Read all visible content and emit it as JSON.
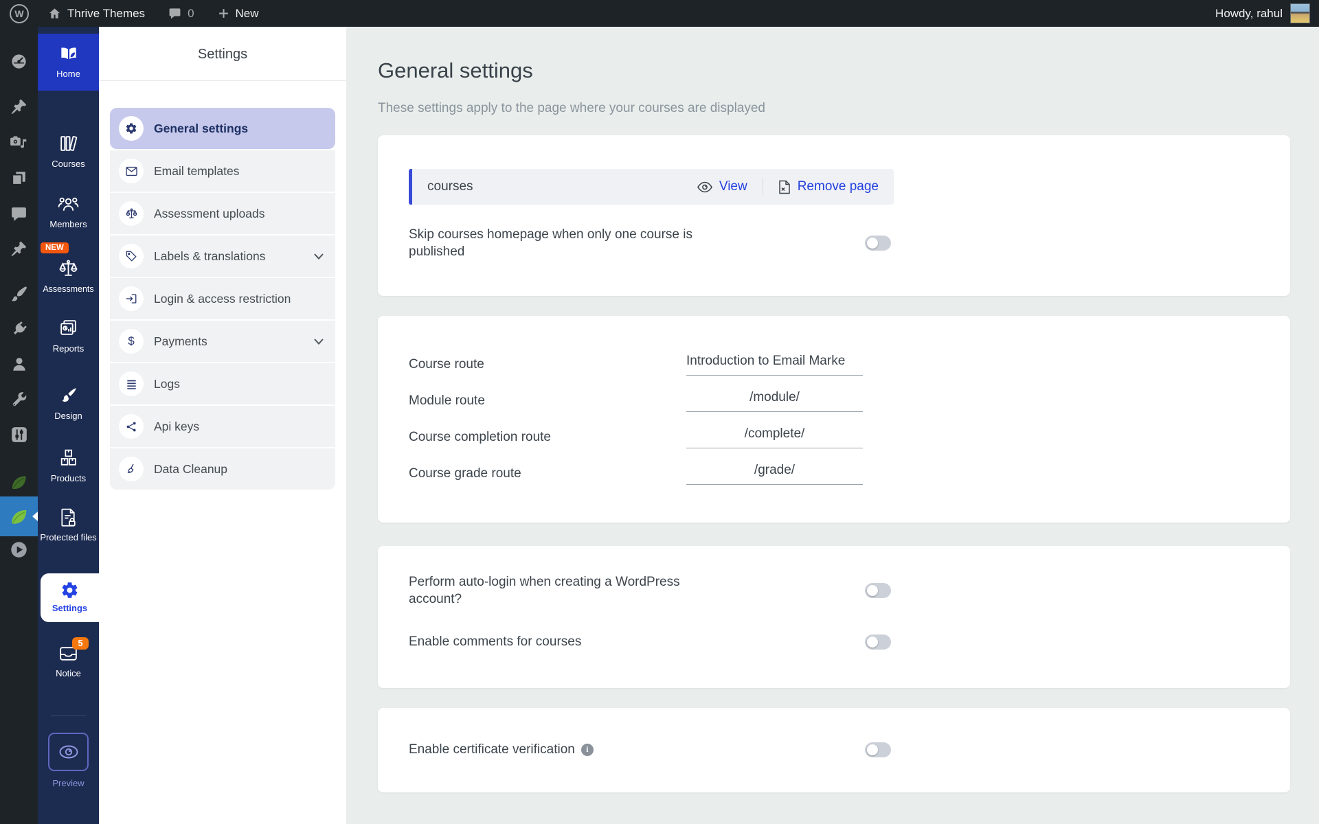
{
  "admin_bar": {
    "site_name": "Thrive Themes",
    "comments_count": "0",
    "new_label": "New",
    "greeting": "Howdy, rahul"
  },
  "wp_strip": {
    "icons": [
      "dashboard",
      "pushpin",
      "media-camera",
      "pages",
      "comments-bubble",
      "pushpin",
      "appearance-brush",
      "plugins-plug",
      "users-person",
      "tools-wrench",
      "settings-sliders",
      "thrive-leaf",
      "thrive-leaf-active",
      "video-play"
    ]
  },
  "thrive_nav": {
    "items": [
      {
        "label": "Home",
        "icon": "book-leaf",
        "active": true
      },
      {
        "label": "Courses",
        "icon": "bookshelf"
      },
      {
        "label": "Members",
        "icon": "people"
      },
      {
        "label": "Assessments",
        "icon": "scales",
        "badge": "NEW"
      },
      {
        "label": "Reports",
        "icon": "report-card"
      },
      {
        "label": "Design",
        "icon": "paintbrush"
      },
      {
        "label": "Products",
        "icon": "boxes"
      },
      {
        "label": "Protected files",
        "icon": "document-lock"
      },
      {
        "label": "Settings",
        "icon": "gear",
        "active": true
      },
      {
        "label": "Notice",
        "icon": "inbox",
        "badge": "5"
      },
      {
        "label": "Preview",
        "icon": "eye"
      }
    ]
  },
  "settings_menu": {
    "title": "Settings",
    "items": [
      {
        "label": "General settings",
        "icon": "gear",
        "active": true
      },
      {
        "label": "Email templates",
        "icon": "envelope"
      },
      {
        "label": "Assessment uploads",
        "icon": "scales"
      },
      {
        "label": "Labels & translations",
        "icon": "tag",
        "expandable": true
      },
      {
        "label": "Login & access restriction",
        "icon": "login-arrow"
      },
      {
        "label": "Payments",
        "icon": "dollar",
        "expandable": true
      },
      {
        "label": "Logs",
        "icon": "list-lines"
      },
      {
        "label": "Api keys",
        "icon": "network"
      },
      {
        "label": "Data Cleanup",
        "icon": "broom"
      }
    ]
  },
  "content": {
    "title": "General settings",
    "subtitle": "These settings apply to the page where your courses are displayed",
    "course_page": {
      "name": "courses",
      "view_label": "View",
      "remove_label": "Remove page"
    },
    "skip_homepage": {
      "label": "Skip courses homepage when only one course is published",
      "enabled": false
    },
    "routes": [
      {
        "label": "Course route",
        "value": "Introduction to Email Marke"
      },
      {
        "label": "Module route",
        "value": "/module/"
      },
      {
        "label": "Course completion route",
        "value": "/complete/"
      },
      {
        "label": "Course grade route",
        "value": "/grade/"
      }
    ],
    "auto_login": {
      "label": "Perform auto-login when creating a WordPress account?",
      "enabled": false
    },
    "enable_comments": {
      "label": "Enable comments for courses",
      "enabled": false
    },
    "certificate_verification": {
      "label": "Enable certificate verification",
      "enabled": false
    }
  },
  "colors": {
    "admin_bar_bg": "#1d2327",
    "sidebar_navy": "#1c2b50",
    "home_tile_blue": "#2038c0",
    "active_strip_blue": "#2e7bc0",
    "accent_link_blue": "#2340df",
    "active_row_lavender": "#c6c9ec",
    "badge_orange": "#f4570e",
    "main_bg": "#e9edeb"
  }
}
